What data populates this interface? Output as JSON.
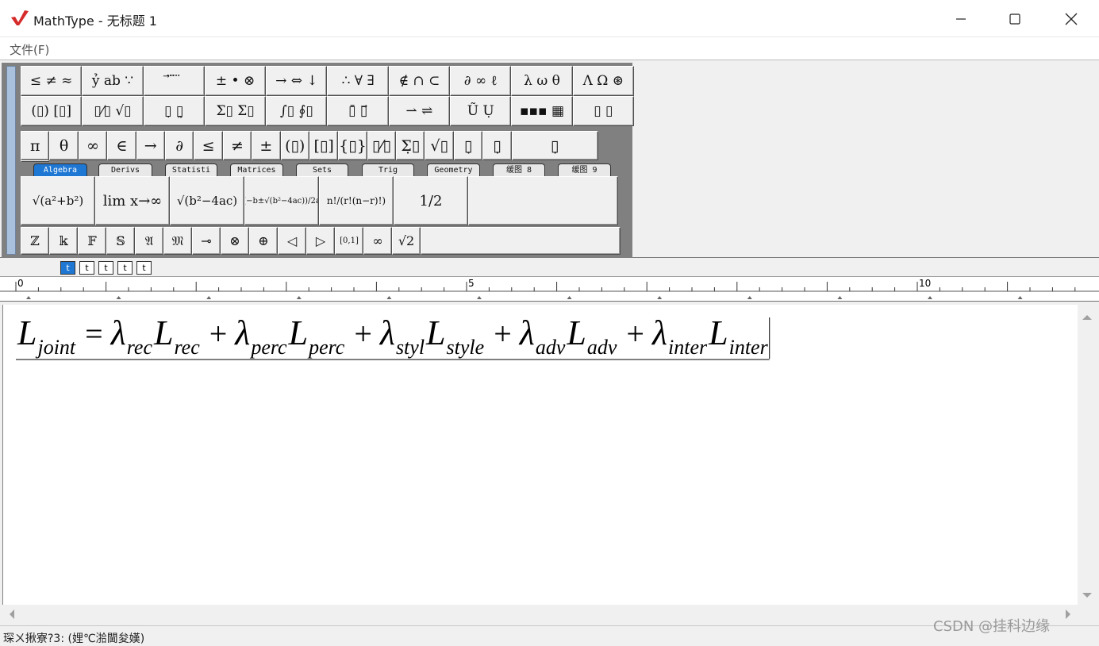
{
  "window": {
    "title": "MathType - 无标题 1",
    "controls": {
      "minimize": "minimize-icon",
      "maximize": "maximize-icon",
      "close": "close-icon"
    }
  },
  "menu": {
    "items": [
      "文件(F)"
    ]
  },
  "toolbar": {
    "symbol_palettes_row1": [
      "≤ ≠ ≈",
      "ỷ ab ∵",
      "⃗ ⃛ ⃜",
      "± • ⊗",
      "→ ⇔ ↓",
      "∴ ∀ ∃",
      "∉ ∩ ⊂",
      "∂ ∞ ℓ",
      "λ ω θ",
      "Λ Ω ⊛"
    ],
    "template_palettes_row2": [
      "(▯) [▯]",
      "▯⁄▯ √▯",
      "▯̣ ▯̰",
      "Σ▯ Σ▯",
      "∫▯ ∮▯",
      "▯̄ ▯⃗",
      "⇀ ⇌",
      "Ũ Ụ",
      "▪▪▪ ▦",
      "▯ ▯"
    ],
    "small_symbols": [
      "π",
      "θ",
      "∞",
      "∈",
      "→",
      "∂",
      "≤",
      "≠",
      "±",
      "(▯)",
      "[▯]",
      "{▯}",
      "▯⁄▯",
      "Σ̣▯",
      "√▯",
      "▯̣",
      "▯̣",
      "▯̣"
    ],
    "tabs": [
      {
        "label": "Algebra",
        "active": true
      },
      {
        "label": "Derivs",
        "active": false
      },
      {
        "label": "Statisti",
        "active": false
      },
      {
        "label": "Matrices",
        "active": false
      },
      {
        "label": "Sets",
        "active": false
      },
      {
        "label": "Trig",
        "active": false
      },
      {
        "label": "Geometry",
        "active": false
      },
      {
        "label": "缓图 8",
        "active": false
      },
      {
        "label": "缓图 9",
        "active": false
      }
    ],
    "expression_templates": [
      "√(a²+b²)",
      "lim x→∞",
      "√(b²−4ac)",
      "(−b±√(b²−4ac))/2a",
      "n!/(r!(n−r)!)",
      "1/2"
    ],
    "bottom_symbols": [
      "ℤ",
      "𝕜",
      "𝔽",
      "𝕊",
      "𝔄",
      "𝔐",
      "⊸",
      "⊗",
      "⊕",
      "◁",
      "▷",
      "[0,1]",
      "∞",
      "√2"
    ],
    "size_buttons": [
      "t",
      "t",
      "t",
      "t",
      "t"
    ]
  },
  "ruler": {
    "labels": [
      "0",
      "5",
      "10"
    ]
  },
  "editor": {
    "equation": "L_joint = λ_rec L_rec + λ_perc L_perc + λ_styl L_style + λ_adv L_adv + λ_inter L_inter",
    "terms": [
      {
        "main": "L",
        "sub": "joint"
      },
      {
        "op": "="
      },
      {
        "main": "λ",
        "sub": "rec"
      },
      {
        "main": "L",
        "sub": "rec"
      },
      {
        "op": "+"
      },
      {
        "main": "λ",
        "sub": "perc"
      },
      {
        "main": "L",
        "sub": "perc"
      },
      {
        "op": "+"
      },
      {
        "main": "λ",
        "sub": "styl"
      },
      {
        "main": "L",
        "sub": "style"
      },
      {
        "op": "+"
      },
      {
        "main": "λ",
        "sub": "adv"
      },
      {
        "main": "L",
        "sub": "adv"
      },
      {
        "op": "+"
      },
      {
        "main": "λ",
        "sub": "inter"
      },
      {
        "main": "L",
        "sub": "inter"
      }
    ]
  },
  "status": {
    "text": "琛ㄨ揪寮?3: (娌℃湁閫夋嫨)"
  },
  "watermark": "CSDN @挂科边缘",
  "colors": {
    "accent": "#1e77d3",
    "logo": "#d62b2b",
    "grip": "#a9c1dc"
  }
}
